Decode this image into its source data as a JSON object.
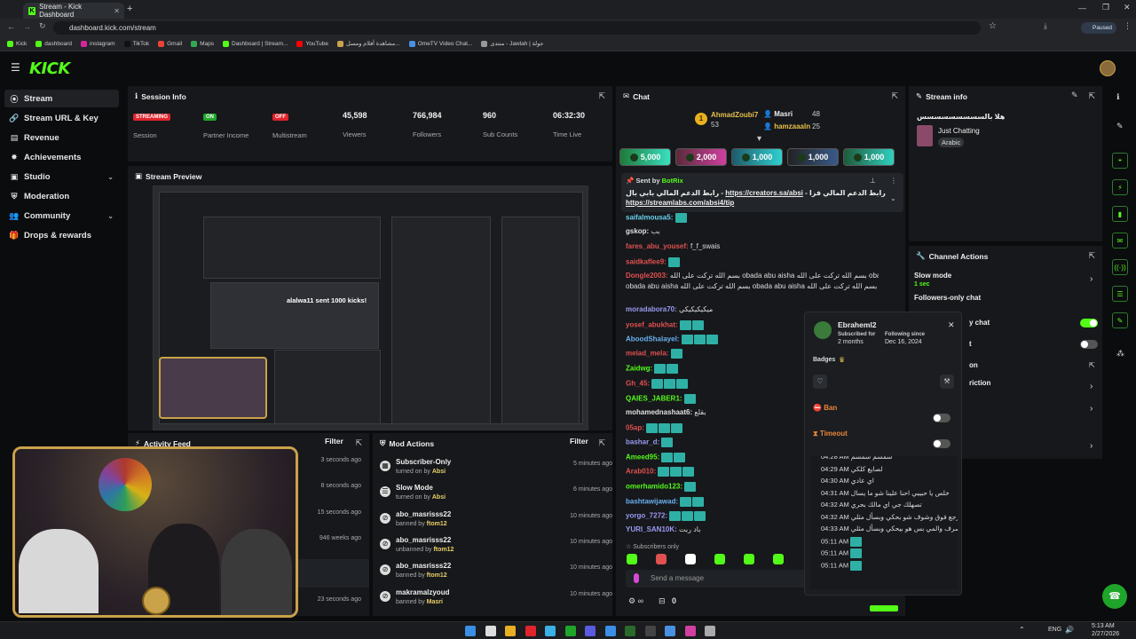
{
  "browser": {
    "tab_title": "Stream - Kick Dashboard",
    "url": "dashboard.kick.com/stream",
    "profile": "Paused",
    "bookmarks": [
      "Kick",
      "dashboard",
      "instagram",
      "TikTok",
      "Gmail",
      "Maps",
      "Dashboard | Stream...",
      "YouTube",
      "مشاهدة أفلام ومسل...",
      "OmeTV Video Chat...",
      "منتدى - Jawlah | جولة"
    ]
  },
  "app": {
    "logo": "KICK"
  },
  "sidebar": {
    "items": [
      {
        "label": "Stream",
        "icon": "stream-icon"
      },
      {
        "label": "Stream URL & Key",
        "icon": "link-icon"
      },
      {
        "label": "Revenue",
        "icon": "revenue-icon"
      },
      {
        "label": "Achievements",
        "icon": "trophy-icon"
      },
      {
        "label": "Studio",
        "icon": "studio-icon"
      },
      {
        "label": "Moderation",
        "icon": "shield-icon"
      },
      {
        "label": "Community",
        "icon": "community-icon"
      },
      {
        "label": "Drops & rewards",
        "icon": "gift-icon"
      }
    ]
  },
  "session": {
    "title": "Session Info",
    "stats": [
      {
        "value": "STREAMING",
        "label": "Session",
        "color": "#e0242c"
      },
      {
        "value": "ON",
        "label": "Partner Income",
        "color": "#1fa52a"
      },
      {
        "value": "OFF",
        "label": "Multistream",
        "color": "#e0242c"
      },
      {
        "value": "45,598",
        "label": "Viewers"
      },
      {
        "value": "766,984",
        "label": "Followers"
      },
      {
        "value": "960",
        "label": "Sub Counts"
      },
      {
        "value": "06:32:30",
        "label": "Time Live"
      }
    ]
  },
  "preview": {
    "title": "Stream Preview",
    "overlay_text": "alalwa11 sent 1000 kicks!"
  },
  "activity": {
    "title": "Activity Feed",
    "filter": "Filter",
    "times": [
      "3 seconds ago",
      "8 seconds ago",
      "15 seconds ago",
      "946 weeks ago",
      "23 seconds ago"
    ]
  },
  "mod": {
    "title": "Mod Actions",
    "filter": "Filter",
    "items": [
      {
        "title": "Subscriber-Only",
        "sub": "turned on by",
        "user": "Absi",
        "time": "5 minutes ago"
      },
      {
        "title": "Slow Mode",
        "sub": "turned on by",
        "user": "Absi",
        "time": "6 minutes ago"
      },
      {
        "title": "abo_masrisss22",
        "sub": "banned by",
        "user": "ftom12",
        "time": "10 minutes ago"
      },
      {
        "title": "abo_masrisss22",
        "sub": "unbanned by",
        "user": "ftom12",
        "time": "10 minutes ago"
      },
      {
        "title": "abo_masrisss22",
        "sub": "banned by",
        "user": "ftom12",
        "time": "10 minutes ago"
      },
      {
        "title": "makramalzyoud",
        "sub": "banned by",
        "user": "Masri",
        "time": "10 minutes ago"
      }
    ]
  },
  "chat": {
    "title": "Chat",
    "leaders": [
      {
        "name": "AhmadZoubi7",
        "count": "53",
        "rank": "1"
      },
      {
        "name": "Masri",
        "count": "48"
      },
      {
        "name": "hamzaaaln",
        "count": "25"
      }
    ],
    "gifts": [
      "5,000",
      "2,000",
      "1,000",
      "1,000",
      "1,000"
    ],
    "pinned": {
      "sent_by": "Sent by",
      "bot": "BotRix",
      "text": "رابط الدعم المالي بابي بال - ",
      "link1": "https://creators.sa/absi",
      "sep": " - رابط الدعم المالي فزا",
      "link2": "https://streamlabs.com/absi4/tip"
    },
    "lines": [
      {
        "user": "saifalmousa5:",
        "color": "#6ad4f0",
        "msg": ""
      },
      {
        "user": "gskop:",
        "color": "#e0e0e0",
        "msg": "بب"
      },
      {
        "user": "fares_abu_yousef:",
        "color": "#e05050",
        "msg": "f_f_swais"
      },
      {
        "user": "saidkaflee9:",
        "color": "#e05050",
        "msg": ""
      },
      {
        "user": "Dongle2003:",
        "color": "#e05050",
        "msg": "بسم الله تركت على الله obada abu aisha بسم الله تركت على الله obada abu"
      },
      {
        "user": "",
        "color": "#e0e0e0",
        "msg": "obada abu aisha بسم الله تركت على الله obada abu aisha بسم الله تركت على الله obada abu aisha"
      },
      {
        "user": "moradabora70:",
        "color": "#9a9af0",
        "msg": "ميكيكيكيكي"
      },
      {
        "user": "yosef_abukhat:",
        "color": "#e05050",
        "msg": ""
      },
      {
        "user": "AboodShalayel:",
        "color": "#6ab0f0",
        "msg": ""
      },
      {
        "user": "melad_mela:",
        "color": "#e05050",
        "msg": ""
      },
      {
        "user": "Zaidwg:",
        "color": "#53fc18",
        "msg": ""
      },
      {
        "user": "Gh_45:",
        "color": "#e05050",
        "msg": ""
      },
      {
        "user": "QAIES_JABER1:",
        "color": "#53fc18",
        "msg": ""
      },
      {
        "user": "mohamednashaat6:",
        "color": "#e0e0e0",
        "msg": "بقلع"
      },
      {
        "user": "05ap:",
        "color": "#e05050",
        "msg": ""
      },
      {
        "user": "bashar_d:",
        "color": "#9a9af0",
        "msg": ""
      },
      {
        "user": "Ameed95:",
        "color": "#53fc18",
        "msg": ""
      },
      {
        "user": "Arab010:",
        "color": "#e05050",
        "msg": ""
      },
      {
        "user": "omerhamido123:",
        "color": "#53fc18",
        "msg": ""
      },
      {
        "user": "bashtawijawad:",
        "color": "#6ab0f0",
        "msg": ""
      },
      {
        "user": "yorgo_7272:",
        "color": "#9a9af0",
        "msg": ""
      },
      {
        "user": "YURI_SAN10K:",
        "color": "#9a9af0",
        "msg": "باد ربت"
      }
    ],
    "subs_only": "Subscribers only",
    "placeholder": "Send a message",
    "count": "0"
  },
  "stream_info": {
    "title": "Stream info",
    "stream_title": "هلا بالسسسسسسسسس",
    "category": "Just Chatting",
    "tag": "Arabic"
  },
  "channel_actions": {
    "title": "Channel Actions",
    "items": [
      {
        "label": "Slow mode",
        "sub": "1 sec"
      },
      {
        "label": "Followers-only chat"
      },
      {
        "label": "y chat"
      },
      {
        "label": "t"
      },
      {
        "label": "on"
      },
      {
        "label": "riction"
      }
    ]
  },
  "user_card": {
    "name": "Ebraheml2",
    "subscribed_label": "Subscribed for",
    "subscribed": "2 months",
    "following_label": "Following since",
    "following": "Dec 16, 2024",
    "badges": "Badges",
    "ban": "Ban",
    "timeout": "Timeout",
    "log": [
      {
        "t": "04:28 AM",
        "m": "سمسم سمسم"
      },
      {
        "t": "04:29 AM",
        "m": "لصايع كلكي"
      },
      {
        "t": "04:30 AM",
        "m": "اي عادي"
      },
      {
        "t": "04:31 AM",
        "m": "خلص يا حبيبي احنا علينا شو ما يسال"
      },
      {
        "t": "04:32 AM",
        "m": "تصهلك جي اي مالك بحري"
      },
      {
        "t": "04:32 AM",
        "m": "ارجع فوق وشوف شو بحكي وبسأل مثلي"
      },
      {
        "t": "04:33 AM",
        "m": "بصرف والمي بس هو بيحكي وبسأل مثلي"
      },
      {
        "t": "05:11 AM",
        "m": ""
      },
      {
        "t": "05:11 AM",
        "m": ""
      },
      {
        "t": "05:11 AM",
        "m": ""
      }
    ]
  },
  "taskbar": {
    "lang": "ENG",
    "time": "5:13 AM",
    "date": "2/27/2026"
  }
}
